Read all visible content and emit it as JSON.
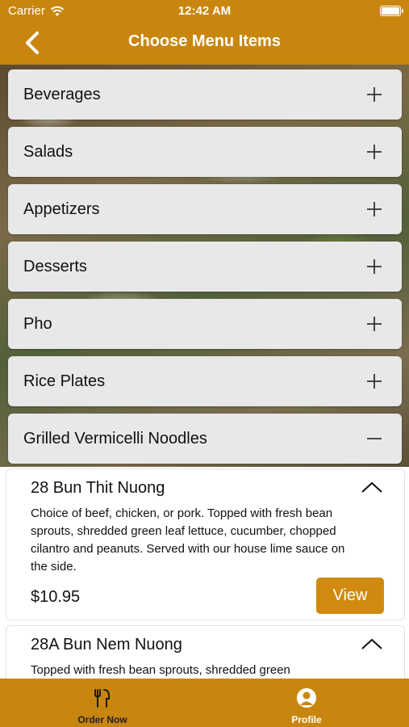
{
  "status_bar": {
    "carrier": "Carrier",
    "time": "12:42 AM"
  },
  "header": {
    "title": "Choose Menu Items"
  },
  "categories": [
    {
      "label": "Beverages",
      "expanded": false
    },
    {
      "label": "Salads",
      "expanded": false
    },
    {
      "label": "Appetizers",
      "expanded": false
    },
    {
      "label": "Desserts",
      "expanded": false
    },
    {
      "label": "Pho",
      "expanded": false
    },
    {
      "label": "Rice Plates",
      "expanded": false
    },
    {
      "label": "Grilled Vermicelli Noodles",
      "expanded": true
    }
  ],
  "items": [
    {
      "name": "28 Bun Thit Nuong",
      "description": "Choice of beef, chicken, or pork. Topped with fresh bean sprouts, shredded green leaf lettuce, cucumber, chopped cilantro and peanuts. Served with our house lime sauce on the side.",
      "price": "$10.95",
      "view_label": "View"
    },
    {
      "name": "28A Bun Nem Nuong",
      "description": "Topped with fresh bean sprouts, shredded green"
    }
  ],
  "tabbar": {
    "order_label": "Order Now",
    "profile_label": "Profile",
    "active": "profile"
  },
  "colors": {
    "accent": "#c9860f",
    "button": "#d08a10",
    "category_bg": "#e8e8e8"
  },
  "icons": {
    "back": "chevron-left-icon",
    "expand": "plus-icon",
    "collapse": "minus-icon",
    "item_toggle": "chevron-up-icon",
    "order": "utensils-icon",
    "profile": "person-icon"
  }
}
